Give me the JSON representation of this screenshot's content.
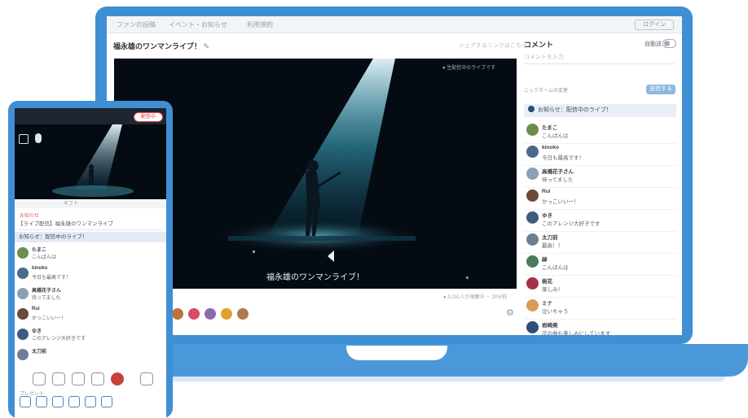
{
  "desktop": {
    "nav": [
      "ファンの投稿",
      "イベント・お知らせ",
      "利用規約"
    ],
    "login_label": "ログイン",
    "stream_title": "福永雄のワンマンライブ！",
    "edit_icon": "pencil-icon",
    "share_label": "シェアするリンクはこちら",
    "video": {
      "top_note": "● 生配信中のライブです",
      "caption": "福永雄のワンマンライブ！",
      "meta": "● 3,291人が視聴中 ・ 20分前"
    },
    "comment_panel": {
      "title": "コメント",
      "auto_scroll_label": "自動送り",
      "placeholder": "コメントを入力",
      "name_note": "ニックネームの変更",
      "post_label": "送信する",
      "pinned": "お知らせ：配信中のライブ！",
      "comments": [
        {
          "name": "たまこ",
          "text": "こんばんは",
          "color": "#6b8e4e"
        },
        {
          "name": "kinoko",
          "text": "今日も最高です！",
          "color": "#4a6a8c"
        },
        {
          "name": "高橋花子さん",
          "text": "待ってました",
          "color": "#8aa0b4"
        },
        {
          "name": "Rui",
          "text": "かっこいいー！",
          "color": "#6b4a3a"
        },
        {
          "name": "ゆき",
          "text": "このアレンジ大好きです",
          "color": "#3d5d7e"
        },
        {
          "name": "太刀前",
          "text": "最高！！",
          "color": "#6d7f93"
        },
        {
          "name": "緑",
          "text": "こんばんは",
          "color": "#4c7a5a"
        },
        {
          "name": "桃花",
          "text": "楽しみ！",
          "color": "#a3314a"
        },
        {
          "name": "ミナ",
          "text": "泣いちゃう",
          "color": "#d99b5a"
        },
        {
          "name": "岩崎美",
          "text": "次の曲も楽しみにしています",
          "color": "#2d4f78"
        }
      ]
    },
    "reactions": [
      "#c0723a",
      "#d84b6a",
      "#8a6bb0",
      "#e0a030",
      "#b07a4a"
    ]
  },
  "mobile": {
    "live_badge": "配信中",
    "videobar_label": "ギフト",
    "label": "お知らせ",
    "title_row": "【ライブ配信】福永雄のワンマンライブ",
    "pinned": "お知らせ：配信中のライブ！",
    "comments": [
      {
        "name": "たまこ",
        "text": "こんばんは",
        "color": "#6b8e4e"
      },
      {
        "name": "kinoko",
        "text": "今日も最高です！",
        "color": "#4a6a8c"
      },
      {
        "name": "高橋花子さん",
        "text": "待ってました",
        "color": "#8aa0b4"
      },
      {
        "name": "Rui",
        "text": "かっこいいー！",
        "color": "#6b4a3a"
      },
      {
        "name": "ゆき",
        "text": "このアレンジ大好きです",
        "color": "#3d5d7e"
      },
      {
        "name": "太刀前",
        "text": "",
        "color": "#6d7f93"
      }
    ],
    "bottom_label": "プレゼント"
  },
  "colors": {
    "device_blue": "#3f8fd4",
    "post_button": "#8cb8e3",
    "pinned_bg": "#e9eef8"
  }
}
